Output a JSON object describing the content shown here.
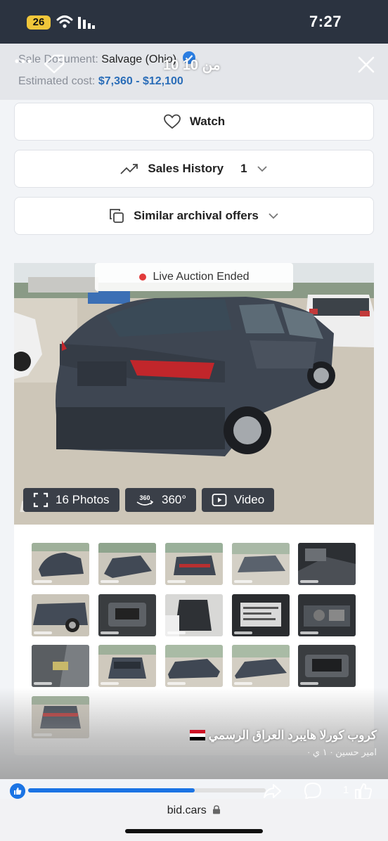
{
  "status_bar": {
    "battery": "26",
    "time": "7:27"
  },
  "overlay": {
    "counter": "10 من 10"
  },
  "listing": {
    "sale_document_label": "Sale Document:",
    "sale_document_value": "Salvage (Ohio)",
    "estimated_cost_label": "Estimated cost:",
    "estimated_cost_value": "$7,360 - $12,100"
  },
  "actions": {
    "watch_label": "Watch",
    "sales_history_label": "Sales History",
    "sales_history_count": "1",
    "similar_offers_label": "Similar archival offers"
  },
  "gallery": {
    "live_status": "Live Auction Ended",
    "watermark": "BIDCARS",
    "photos_label": "16 Photos",
    "view360_label": "360°",
    "view360_icon_text": "360",
    "video_label": "Video",
    "thumbnails": [
      "rear-left",
      "rear-right",
      "rear",
      "rear-wide",
      "interior-front",
      "side-damage",
      "dashboard",
      "seat",
      "label-plate",
      "engine-bay",
      "door-panel",
      "front",
      "side-left",
      "side-right",
      "screen",
      "rear-night"
    ]
  },
  "social": {
    "group_title": "كروب كورلا هايبرد العراق الرسمي",
    "author_line": "امير حسين · ١ ي ·",
    "like_count": "1",
    "progress_percent": 70
  },
  "browser": {
    "url": "bid.cars"
  },
  "colors": {
    "accent_blue": "#2a6db8",
    "status_bg": "#2b3340",
    "fb_blue": "#1b74e4",
    "live_dot": "#e23b3b"
  }
}
